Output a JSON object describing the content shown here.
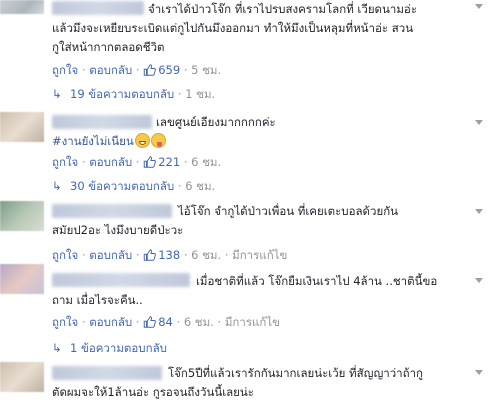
{
  "comments": [
    {
      "lines": [
        "จำเราได้ป่าวโจ๊ก ที่เราไปรบสงครามโลกที่ เวียดนามอ่ะ",
        "แล้วมึงจะเหยียบระเบิดแต่กูไปกันมึงออกมา ทำให้มึงเป็นหลุมที่หน้าอ่ะ สวน",
        "กูใส่หน้ากากตลอดชีวิต"
      ],
      "like_label": "ถูกใจ",
      "reply_label": "ตอบกลับ",
      "likes": "659",
      "time": "5 ชม.",
      "edited": "",
      "replies_text": "19 ข้อความตอบกลับ",
      "replies_time": "1 ชม."
    },
    {
      "line1": "เลขศูนย์เอียงมากกกกค่ะ",
      "hashtag": "#งานยังไม่เนียน",
      "like_label": "ถูกใจ",
      "reply_label": "ตอบกลับ",
      "likes": "221",
      "time": "6 ชม.",
      "replies_text": "30 ข้อความตอบกลับ",
      "replies_time": "6 ชม."
    },
    {
      "lines": [
        "ไอ้โจ๊ก จำกูได้ป่าวเพื่อน ที่เคยเตะบอลด้วยกัน",
        "สมัยป2อะ ไงมึงบายดีป่ะวะ"
      ],
      "like_label": "ถูกใจ",
      "reply_label": "ตอบกลับ",
      "likes": "138",
      "time": "6 ชม.",
      "edited": "มีการแก้ไข"
    },
    {
      "lines": [
        "เมื่อชาติที่แล้ว โจ๊กยืมเงินเราไป 4ล้าน ..ชาตินี้ขอ",
        "ถาม เมื่อไรจะคืน.."
      ],
      "like_label": "ถูกใจ",
      "reply_label": "ตอบกลับ",
      "likes": "84",
      "time": "6 ชม.",
      "edited": "มีการแก้ไข",
      "replies_text": "1 ข้อความตอบกลับ"
    },
    {
      "lines": [
        "โจ๊ก5ปีที่แล้วเรารักกันมากเลยน่ะเว้ย ที่สัญญาว่าถ้ากู",
        "ตัดผมจะให้1ล้านอ่ะ กูรอจนถึงวันนี้เลยน่ะ"
      ]
    }
  ],
  "separator": "·"
}
